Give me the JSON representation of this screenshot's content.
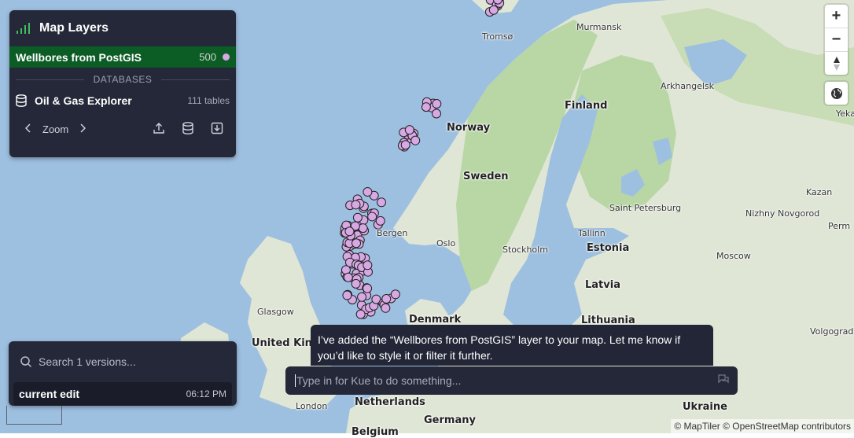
{
  "layers_panel": {
    "title": "Map Layers",
    "layer": {
      "name": "Wellbores from PostGIS",
      "count": "500",
      "color": "#d7a8e4"
    },
    "section_label": "DATABASES",
    "database": {
      "name": "Oil & Gas Explorer",
      "tables": "111 tables"
    },
    "zoom_label": "Zoom"
  },
  "versions_panel": {
    "search_placeholder": "Search 1 versions...",
    "version": {
      "name": "current edit",
      "time": "06:12 PM"
    }
  },
  "chat": {
    "message": "I’ve added the “Wellbores from PostGIS” layer to your map. Let me know if you’d like to style it or filter it further.",
    "input_placeholder": "Type in for Kue to do something..."
  },
  "map": {
    "countries": [
      "Norway",
      "Sweden",
      "Finland",
      "Denmark",
      "Estonia",
      "Latvia",
      "Lithuania",
      "United Kingdom",
      "Netherlands",
      "Germany",
      "Belgium",
      "Ukraine"
    ],
    "cities": [
      "Tromsø",
      "Murmansk",
      "Arkhangelsk",
      "Bergen",
      "Oslo",
      "Stockholm",
      "Tallinn",
      "Saint Petersburg",
      "Kazan",
      "Nizhny Novgorod",
      "Moscow",
      "Glasgow",
      "London",
      "Volgograd",
      "Yeka",
      "Perm"
    ],
    "colors": {
      "water": "#9ec0e0",
      "land": "#dfe6d5",
      "forest": "#b9d6a5",
      "wellbore": "#d7a8e4"
    }
  },
  "controls": {
    "zoom_in": "+",
    "zoom_out": "−"
  },
  "attribution": "© MapTiler © OpenStreetMap contributors"
}
